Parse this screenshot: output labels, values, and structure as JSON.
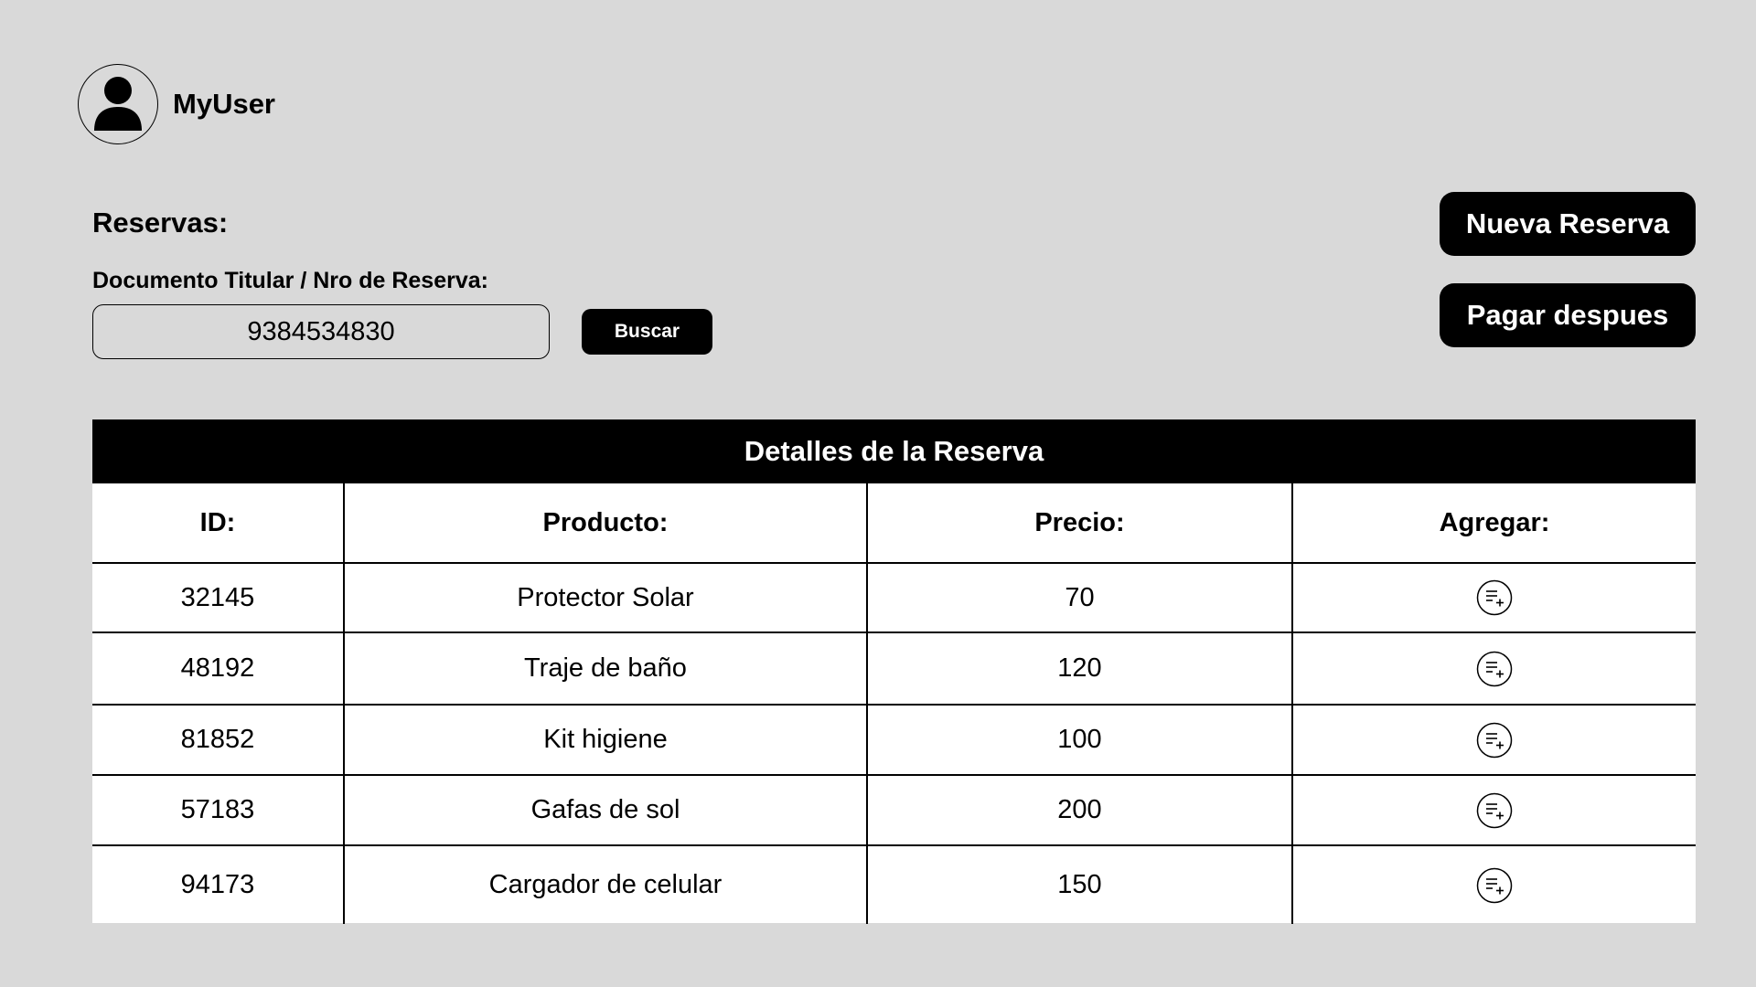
{
  "user": {
    "name": "MyUser",
    "avatar_icon": "user-icon"
  },
  "reservations": {
    "title": "Reservas:",
    "search_label": "Documento Titular / Nro de Reserva:",
    "search_value": "9384534830",
    "search_button": "Buscar"
  },
  "actions": {
    "new_reservation": "Nueva Reserva",
    "pay_later": "Pagar despues"
  },
  "table": {
    "title": "Detalles de la Reserva",
    "headers": [
      "ID:",
      "Producto:",
      "Precio:",
      "Agregar:"
    ],
    "rows": [
      {
        "id": "32145",
        "product": "Protector Solar",
        "price": "70"
      },
      {
        "id": "48192",
        "product": "Traje de baño",
        "price": "120"
      },
      {
        "id": "81852",
        "product": "Kit higiene",
        "price": "100"
      },
      {
        "id": "57183",
        "product": "Gafas de sol",
        "price": "200"
      },
      {
        "id": "94173",
        "product": "Cargador de celular",
        "price": "150"
      }
    ],
    "add_icon": "playlist-add-icon"
  },
  "colors": {
    "background": "#d9d9d9",
    "primary": "#000000",
    "surface": "#ffffff"
  }
}
